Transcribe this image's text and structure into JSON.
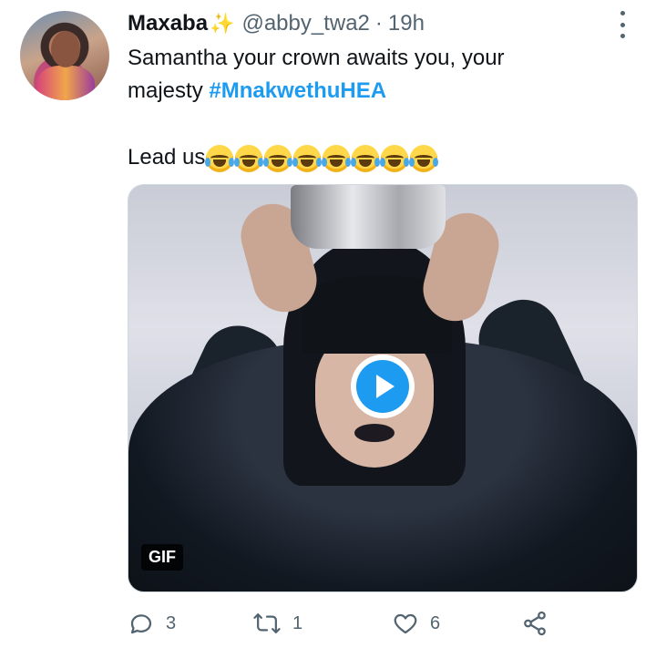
{
  "tweet": {
    "author_name": "Maxaba",
    "author_emoji": "✨",
    "handle": "@abby_twa2",
    "separator": "·",
    "time": "19h",
    "text_line1": "Samantha your crown awaits you, your",
    "text_line2_prefix": "majesty ",
    "hashtag": "#MnakwethuHEA",
    "lead_text": "Lead us",
    "emoji_count_label": "😂😂😂😂😂😂😂😂",
    "media": {
      "badge": "GIF",
      "play_icon": "play-icon"
    },
    "actions": {
      "reply_count": "3",
      "retweet_count": "1",
      "like_count": "6"
    },
    "colors": {
      "accent": "#1d9bf0",
      "secondary_text": "#536471",
      "primary_text": "#0f1419"
    }
  }
}
